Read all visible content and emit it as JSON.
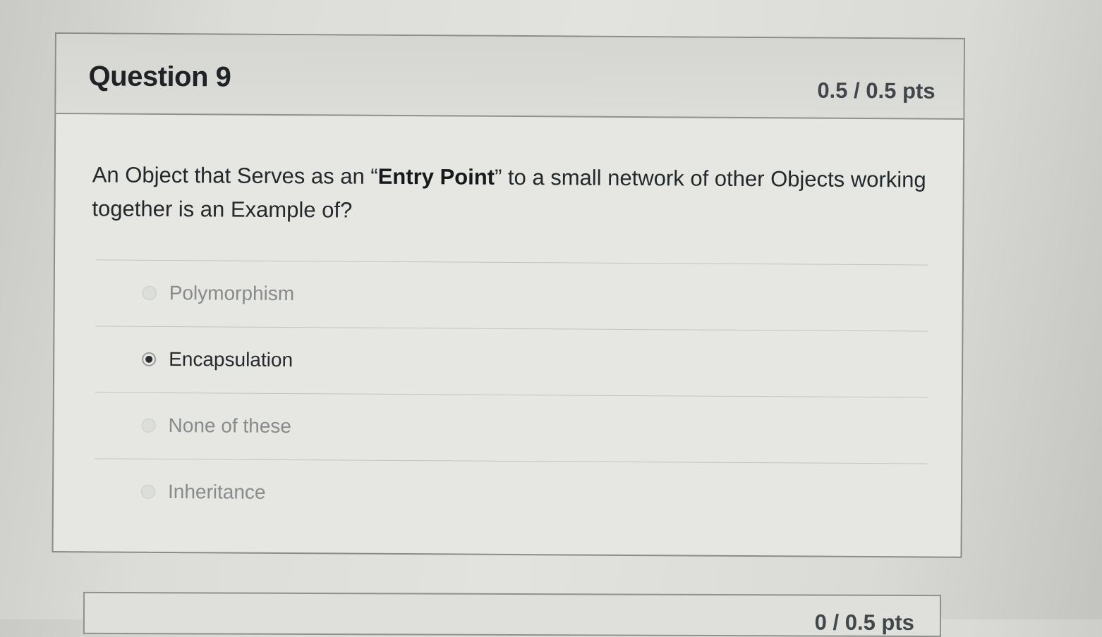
{
  "question": {
    "title": "Question 9",
    "points": "0.5 / 0.5 pts",
    "text_before": "An Object that Serves as an “",
    "text_bold": "Entry Point",
    "text_after": "” to a small network of other Objects working together is an Example of?"
  },
  "answers": [
    {
      "label": "Polymorphism",
      "selected": false
    },
    {
      "label": "Encapsulation",
      "selected": true
    },
    {
      "label": "None of these",
      "selected": false
    },
    {
      "label": "Inheritance",
      "selected": false
    }
  ],
  "next_question": {
    "points": "0 / 0.5 pts"
  }
}
